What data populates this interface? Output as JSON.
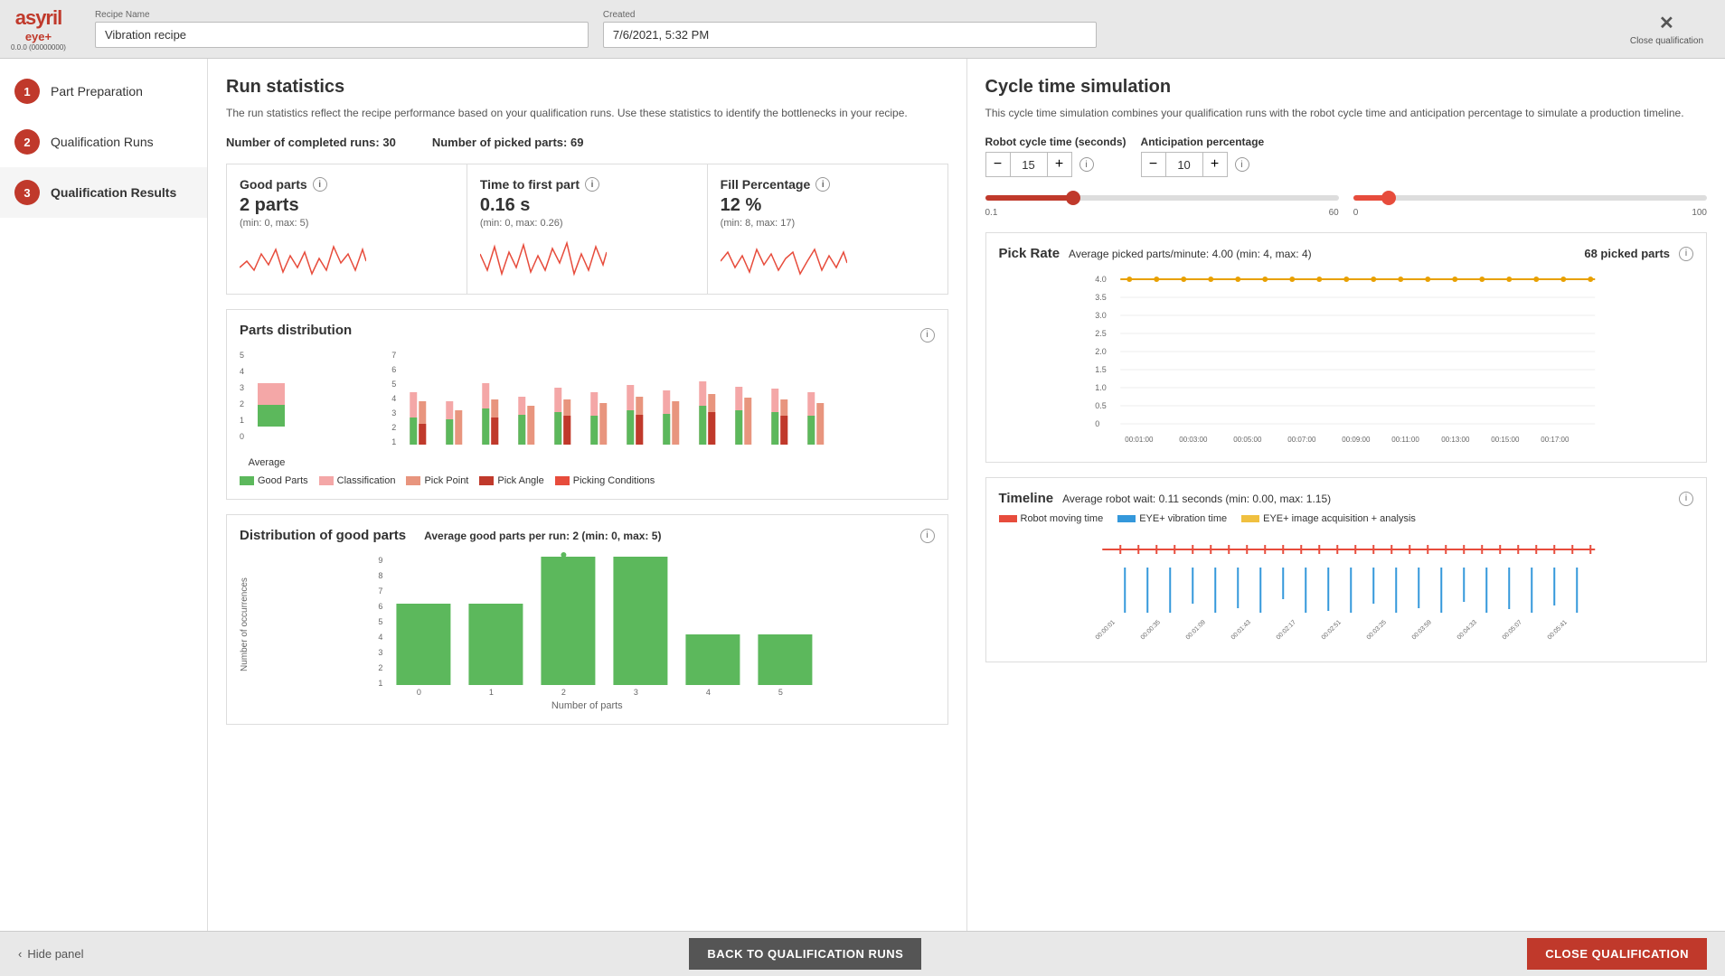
{
  "app": {
    "name": "asyril",
    "subtitle": "eye+",
    "version": "0.0.0 (00000000)"
  },
  "topbar": {
    "recipe_label": "Recipe Name",
    "recipe_value": "Vibration recipe",
    "created_label": "Created",
    "created_value": "7/6/2021, 5:32 PM",
    "close_label": "Close qualification"
  },
  "sidebar": {
    "items": [
      {
        "number": "1",
        "label": "Part Preparation"
      },
      {
        "number": "2",
        "label": "Qualification Runs"
      },
      {
        "number": "3",
        "label": "Qualification Results"
      }
    ],
    "hide_label": "Hide panel"
  },
  "left_panel": {
    "title": "Run statistics",
    "description": "The run statistics reflect the recipe performance based on your qualification runs. Use these statistics to identify the bottlenecks in your recipe.",
    "completed_runs_label": "Number of completed runs:",
    "completed_runs_value": "30",
    "picked_parts_label": "Number of picked parts:",
    "picked_parts_value": "69",
    "metrics": [
      {
        "title": "Good parts",
        "value": "2 parts",
        "range": "(min: 0, max: 5)"
      },
      {
        "title": "Time to first part",
        "value": "0.16 s",
        "range": "(min: 0, max: 0.26)"
      },
      {
        "title": "Fill Percentage",
        "value": "12 %",
        "range": "(min: 8, max: 17)"
      }
    ],
    "parts_dist": {
      "title": "Parts distribution",
      "legend": [
        {
          "label": "Good Parts",
          "color": "#5cb85c"
        },
        {
          "label": "Classification",
          "color": "#f4a7a7"
        },
        {
          "label": "Pick Point",
          "color": "#e8957e"
        },
        {
          "label": "Pick Angle",
          "color": "#c0392b"
        },
        {
          "label": "Picking Conditions",
          "color": "#e74c3c"
        }
      ],
      "average_label": "Average"
    },
    "good_parts_dist": {
      "title": "Distribution of good parts",
      "stats": "Average good parts per run: 2 (min: 0, max: 5)",
      "y_label": "Number of occurrences"
    }
  },
  "right_panel": {
    "title": "Cycle time simulation",
    "description": "This cycle time simulation combines your qualification runs with the robot cycle time and anticipation percentage to simulate a production timeline.",
    "robot_cycle_label": "Robot cycle time (seconds)",
    "robot_cycle_value": "15",
    "anticipation_label": "Anticipation percentage",
    "anticipation_value": "10",
    "slider1": {
      "min": "0.1",
      "max": "60",
      "value": 25
    },
    "slider2": {
      "min": "0",
      "max": "100",
      "value": 10
    },
    "pick_rate": {
      "title": "Pick Rate",
      "stats": "Average picked parts/minute: 4.00 (min: 4, max: 4)",
      "picked_parts": "68 picked parts",
      "y_max": "4.0",
      "y_values": [
        "4.0",
        "3.5",
        "3.0",
        "2.5",
        "2.0",
        "1.5",
        "1.0",
        "0.5",
        "0"
      ],
      "x_values": [
        "00:01:00",
        "00:03:00",
        "00:05:00",
        "00:07:00",
        "00:09:00",
        "00:11:00",
        "00:13:00",
        "00:15:00",
        "00:17:00"
      ]
    },
    "timeline": {
      "title": "Timeline",
      "stats": "Average robot wait: 0.11 seconds (min: 0.00, max: 1.15)",
      "legend": [
        {
          "label": "Robot moving time",
          "color": "#e74c3c"
        },
        {
          "label": "EYE+ vibration time",
          "color": "#3498db"
        },
        {
          "label": "EYE+ image acquisition + analysis",
          "color": "#f0c040"
        }
      ]
    }
  },
  "bottom": {
    "back_label": "BACK TO QUALIFICATION RUNS",
    "close_label": "CLOSE QUALIFICATION"
  }
}
